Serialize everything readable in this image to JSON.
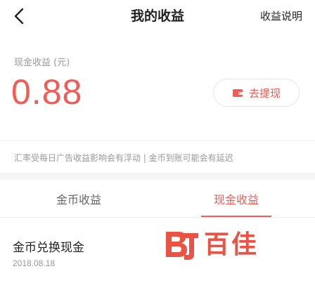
{
  "header": {
    "title": "我的收益",
    "help_label": "收益说明"
  },
  "earnings": {
    "label": "现金收益 (元)",
    "amount": "0.88",
    "withdraw_label": "去提现"
  },
  "notice": {
    "text": "汇率受每日广告收益影响会有浮动 | 金币到账可能会有延迟"
  },
  "tabs": [
    {
      "label": "金币收益",
      "active": false
    },
    {
      "label": "现金收益",
      "active": true
    }
  ],
  "records": [
    {
      "title": "金币兑换现金",
      "date": "2018.08.18"
    }
  ],
  "watermark": {
    "text": "百佳"
  },
  "colors": {
    "accent": "#f25c55",
    "muted": "#999999"
  },
  "icons": {
    "back": "chevron-left-icon",
    "withdraw": "wallet-icon",
    "watermark_logo": "bj-logo-icon"
  }
}
